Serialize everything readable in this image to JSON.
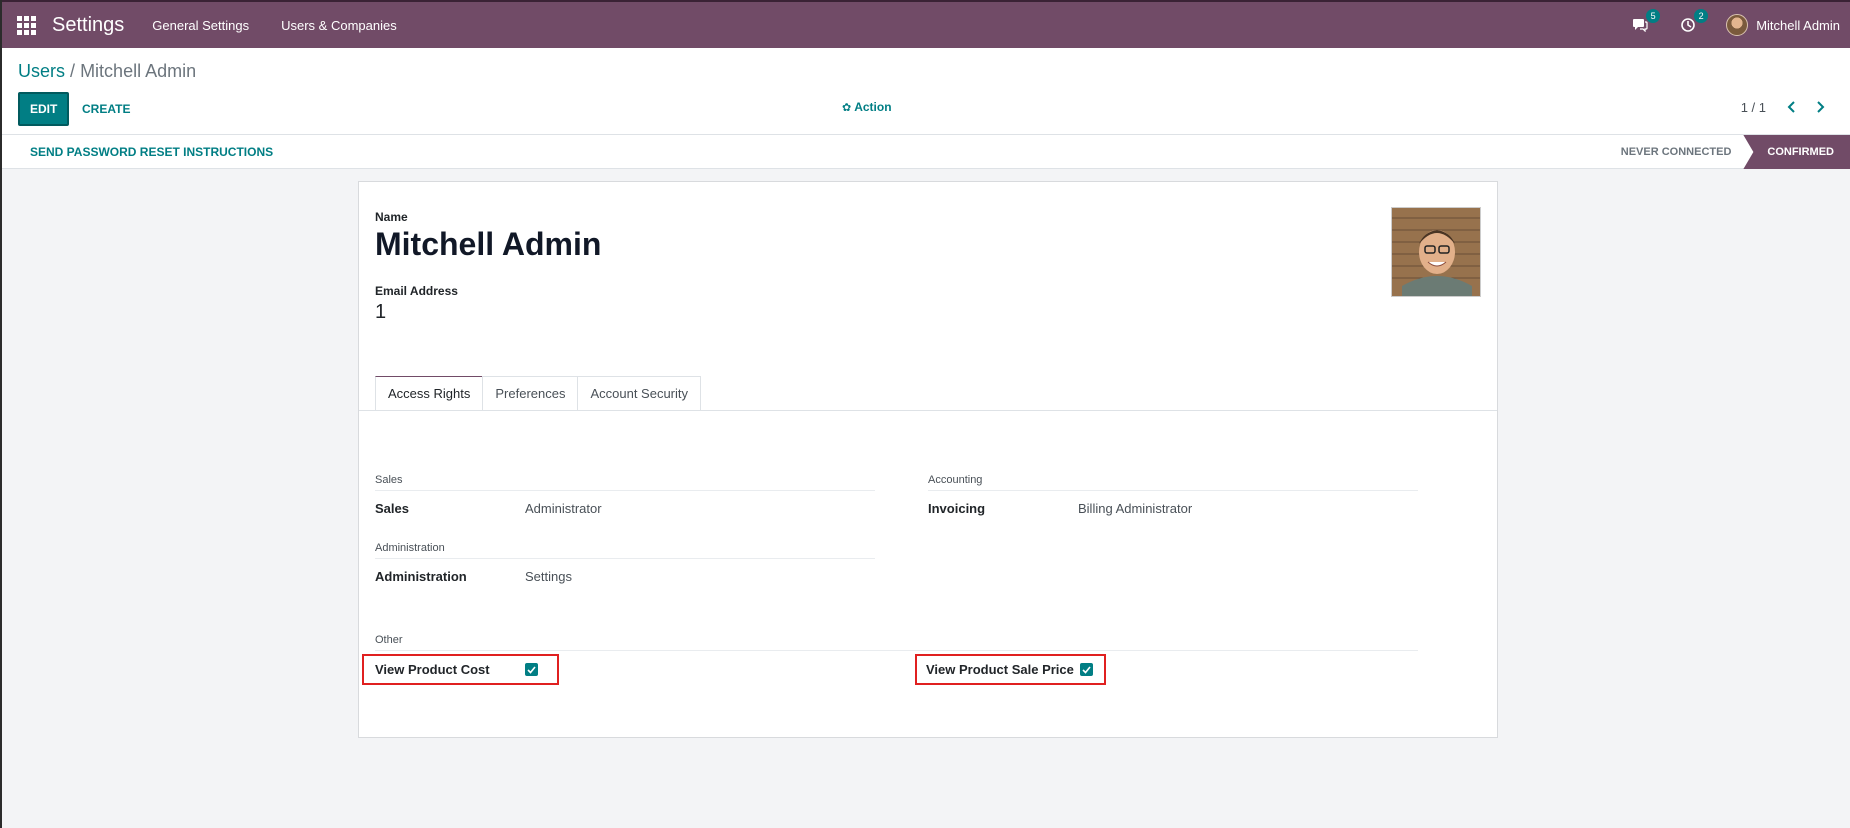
{
  "navbar": {
    "app_title": "Settings",
    "menu": [
      "General Settings",
      "Users & Companies"
    ],
    "messages_count": "5",
    "activities_count": "2",
    "user_name": "Mitchell Admin",
    "color": "#714b67"
  },
  "control_panel": {
    "breadcrumb_parent": "Users",
    "breadcrumb_separator": "/",
    "breadcrumb_current": "Mitchell Admin",
    "edit_label": "EDIT",
    "create_label": "CREATE",
    "action_label": "Action",
    "pager": "1 / 1"
  },
  "statusbar": {
    "reset_label": "SEND PASSWORD RESET INSTRUCTIONS",
    "stages": [
      {
        "label": "NEVER CONNECTED",
        "active": false
      },
      {
        "label": "CONFIRMED",
        "active": true
      }
    ]
  },
  "form": {
    "name_label": "Name",
    "name_value": "Mitchell Admin",
    "email_label": "Email Address",
    "email_value": "1",
    "tabs": [
      {
        "label": "Access Rights",
        "active": true
      },
      {
        "label": "Preferences",
        "active": false
      },
      {
        "label": "Account Security",
        "active": false
      }
    ],
    "groups": {
      "sales": {
        "title": "Sales",
        "field": "Sales",
        "value": "Administrator"
      },
      "accounting": {
        "title": "Accounting",
        "field": "Invoicing",
        "value": "Billing Administrator"
      },
      "administration": {
        "title": "Administration",
        "field": "Administration",
        "value": "Settings"
      },
      "other": {
        "title": "Other",
        "view_product_cost": {
          "label": "View Product Cost",
          "checked": true
        },
        "view_product_sale_price": {
          "label": "View Product Sale Price",
          "checked": true
        }
      }
    }
  },
  "colors": {
    "primary": "#017e84",
    "brand": "#714b67",
    "highlight": "#e02020"
  }
}
